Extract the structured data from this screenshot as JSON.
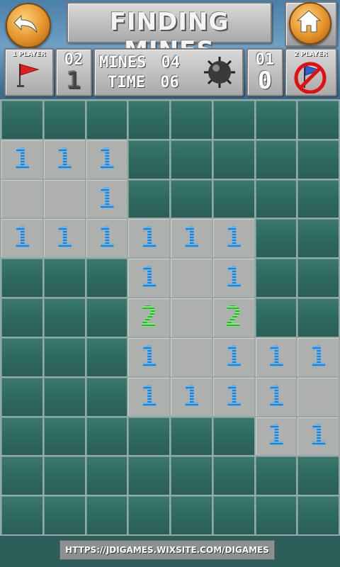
{
  "header": {
    "title": "FINDING MINES",
    "back_icon": "undo-arrow-icon",
    "home_icon": "home-icon"
  },
  "player1": {
    "label": "1 PLAYER",
    "icon": "red-flag-icon",
    "score": "02",
    "flags": "1"
  },
  "status": {
    "mines_label": "MINES",
    "mines_value": "04",
    "time_label": "TIME",
    "time_value": "06",
    "icon": "mine-icon"
  },
  "player2": {
    "label": "2 PLAYER",
    "icon": "blue-flag-disabled-icon",
    "score": "01",
    "flags": "0"
  },
  "board": {
    "rows": 11,
    "cols": 8,
    "cells": [
      [
        "H",
        "H",
        "H",
        "H",
        "H",
        "H",
        "H",
        "H"
      ],
      [
        "1",
        "1",
        "1",
        "H",
        "H",
        "H",
        "H",
        "H"
      ],
      [
        " ",
        " ",
        "1",
        "H",
        "H",
        "H",
        "H",
        "H"
      ],
      [
        "1",
        "1",
        "1",
        "1",
        "1",
        "1",
        "H",
        "H"
      ],
      [
        "H",
        "H",
        "H",
        "1",
        " ",
        "1",
        "H",
        "H"
      ],
      [
        "H",
        "H",
        "H",
        "2",
        " ",
        "2",
        "H",
        "H"
      ],
      [
        "H",
        "H",
        "H",
        "1",
        " ",
        "1",
        "1",
        "1"
      ],
      [
        "H",
        "H",
        "H",
        "1",
        "1",
        "1",
        "1",
        " "
      ],
      [
        "H",
        "H",
        "H",
        "H",
        "H",
        "H",
        "1",
        "1"
      ],
      [
        "H",
        "H",
        "H",
        "H",
        "H",
        "H",
        "H",
        "H"
      ],
      [
        "H",
        "H",
        "H",
        "H",
        "H",
        "H",
        "H",
        "H"
      ]
    ]
  },
  "footer": {
    "url": "HTTPS://JDIGAMES.WIXSITE.COM/DIGAMES"
  },
  "colors": {
    "number_1": "#4aa3ea",
    "number_2": "#4dd34d",
    "hidden_tile": "#2f6a60",
    "open_tile": "#aeb0ae"
  }
}
